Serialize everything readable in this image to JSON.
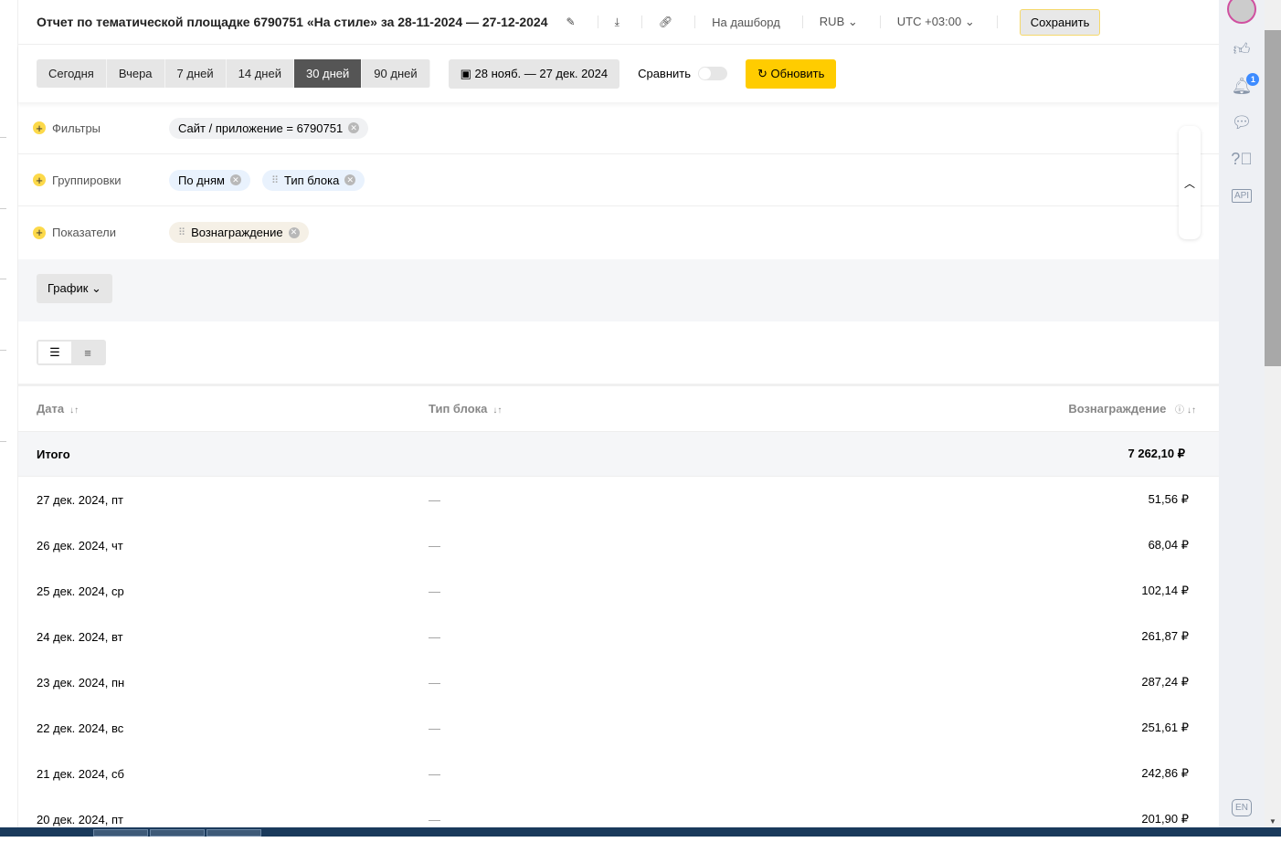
{
  "header": {
    "title": "Отчет по тематической площадке 6790751 «На стиле» за 28-11-2024 — 27-12-2024",
    "dashboard": "На дашборд",
    "currency": "RUB",
    "timezone": "UTC +03:00",
    "save": "Сохранить"
  },
  "periods": [
    "Сегодня",
    "Вчера",
    "7 дней",
    "14 дней",
    "30 дней",
    "90 дней"
  ],
  "active_period": "30 дней",
  "date_range": "28 нояб. — 27 дек. 2024",
  "compare": "Сравнить",
  "refresh": "Обновить",
  "filters": {
    "label": "Фильтры",
    "chips": [
      "Сайт / приложение = 6790751"
    ]
  },
  "groupings": {
    "label": "Группировки",
    "chips": [
      "По дням",
      "Тип блока"
    ]
  },
  "metrics": {
    "label": "Показатели",
    "chips": [
      "Вознаграждение"
    ]
  },
  "chart_button": "График",
  "table": {
    "headers": [
      "Дата",
      "Тип блока",
      "Вознаграждение"
    ],
    "total": {
      "label": "Итого",
      "value": "7 262,10 ₽"
    },
    "rows": [
      {
        "date": "27 дек. 2024, пт",
        "type": "—",
        "value": "51,56 ₽"
      },
      {
        "date": "26 дек. 2024, чт",
        "type": "—",
        "value": "68,04 ₽"
      },
      {
        "date": "25 дек. 2024, ср",
        "type": "—",
        "value": "102,14 ₽"
      },
      {
        "date": "24 дек. 2024, вт",
        "type": "—",
        "value": "261,87 ₽"
      },
      {
        "date": "23 дек. 2024, пн",
        "type": "—",
        "value": "287,24 ₽"
      },
      {
        "date": "22 дек. 2024, вс",
        "type": "—",
        "value": "251,61 ₽"
      },
      {
        "date": "21 дек. 2024, сб",
        "type": "—",
        "value": "242,86 ₽"
      },
      {
        "date": "20 дек. 2024, пт",
        "type": "—",
        "value": "201,90 ₽"
      }
    ]
  },
  "sidebar": {
    "notifications": "1",
    "api": "API",
    "lang": "EN"
  }
}
